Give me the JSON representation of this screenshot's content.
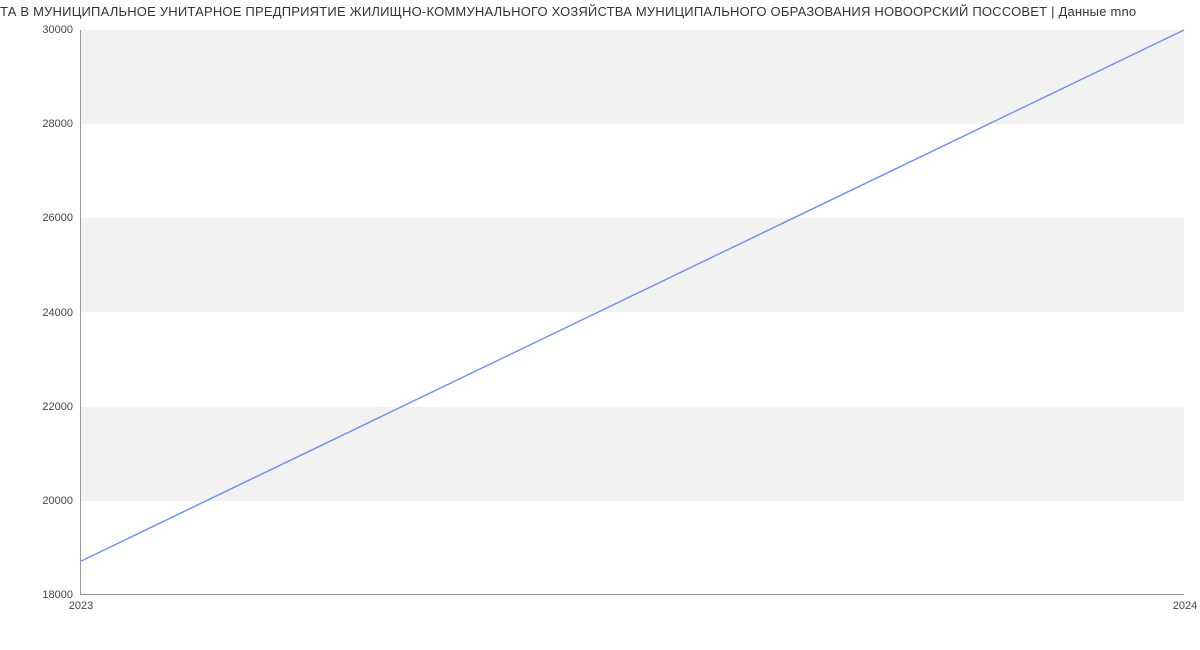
{
  "title": "ТА В МУНИЦИПАЛЬНОЕ УНИТАРНОЕ ПРЕДПРИЯТИЕ ЖИЛИЩНО-КОММУНАЛЬНОГО ХОЗЯЙСТВА МУНИЦИПАЛЬНОГО ОБРАЗОВАНИЯ НОВООРСКИЙ ПОССОВЕТ | Данные mno",
  "chart_data": {
    "type": "line",
    "x": [
      2023,
      2024
    ],
    "values": [
      18700,
      30000
    ],
    "title": "ТА В МУНИЦИПАЛЬНОЕ УНИТАРНОЕ ПРЕДПРИЯТИЕ ЖИЛИЩНО-КОММУНАЛЬНОГО ХОЗЯЙСТВА МУНИЦИПАЛЬНОГО ОБРАЗОВАНИЯ НОВООРСКИЙ ПОССОВЕТ | Данные mno",
    "xlabel": "",
    "ylabel": "",
    "xlim": [
      2023,
      2024
    ],
    "ylim": [
      18000,
      30000
    ],
    "x_ticks": [
      2023,
      2024
    ],
    "y_ticks": [
      18000,
      20000,
      22000,
      24000,
      26000,
      28000,
      30000
    ],
    "line_color": "#6b8ff0",
    "grid_band_color": "#f2f2f2"
  }
}
